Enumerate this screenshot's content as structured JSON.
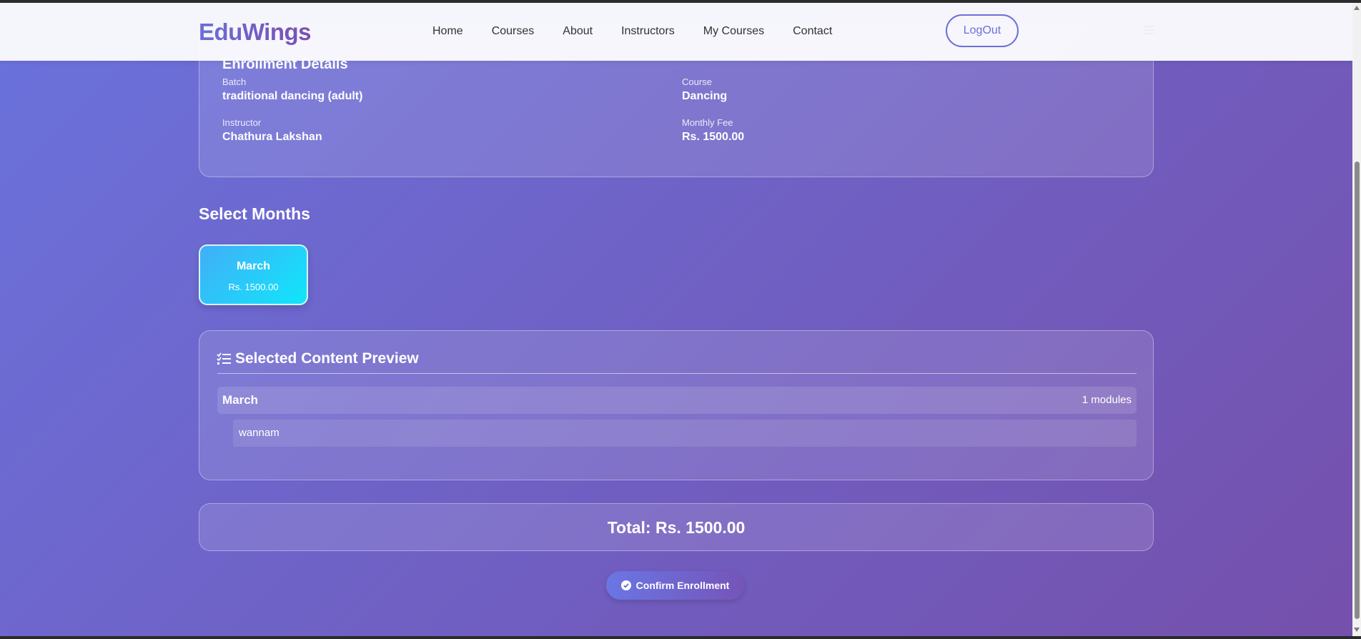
{
  "nav": {
    "logo": "EduWings",
    "links": [
      "Home",
      "Courses",
      "About",
      "Instructors",
      "My Courses",
      "Contact"
    ],
    "logout_label": "LogOut"
  },
  "enrollment": {
    "title": "Enrollment Details",
    "batch_label": "Batch",
    "batch_value": "traditional dancing (adult)",
    "course_label": "Course",
    "course_value": "Dancing",
    "instructor_label": "Instructor",
    "instructor_value": "Chathura Lakshan",
    "fee_label": "Monthly Fee",
    "fee_value": "Rs. 1500.00"
  },
  "months": {
    "title": "Select Months",
    "items": [
      {
        "name": "March",
        "fee": "Rs. 1500.00",
        "selected": true
      }
    ]
  },
  "preview": {
    "title": "Selected Content Preview",
    "groups": [
      {
        "month": "March",
        "count": "1 modules",
        "modules": [
          "wannam"
        ]
      }
    ]
  },
  "total": {
    "text": "Total: Rs. 1500.00"
  },
  "confirm_label": "Confirm Enrollment",
  "colors": {
    "accent": "#6a70d8",
    "selected_month_start": "#42aef8",
    "selected_month_end": "#10e6fa"
  }
}
